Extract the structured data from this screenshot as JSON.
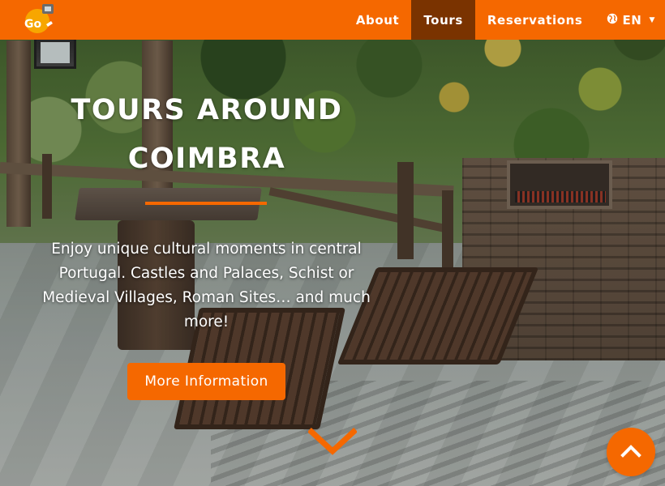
{
  "navbar": {
    "logo_icon": "go-logo-icon",
    "items": [
      {
        "label": "About",
        "active": false
      },
      {
        "label": "Tours",
        "active": true
      },
      {
        "label": "Reservations",
        "active": false
      }
    ],
    "language": {
      "label": "EN",
      "icon": "globe-icon"
    }
  },
  "hero": {
    "title_line1": "TOURS AROUND",
    "title_line2": "COIMBRA",
    "subtitle": "Enjoy unique cultural moments in central Portugal. Castles and Palaces, Schist or Medieval Villages, Roman Sites… and much more!",
    "button_label": "More Information",
    "scroll_icon": "chevron-down-icon"
  },
  "back_to_top": {
    "icon": "chevron-up-icon"
  },
  "colors": {
    "accent": "#f56800",
    "active_nav": "#7a3300",
    "text": "#ffffff"
  }
}
